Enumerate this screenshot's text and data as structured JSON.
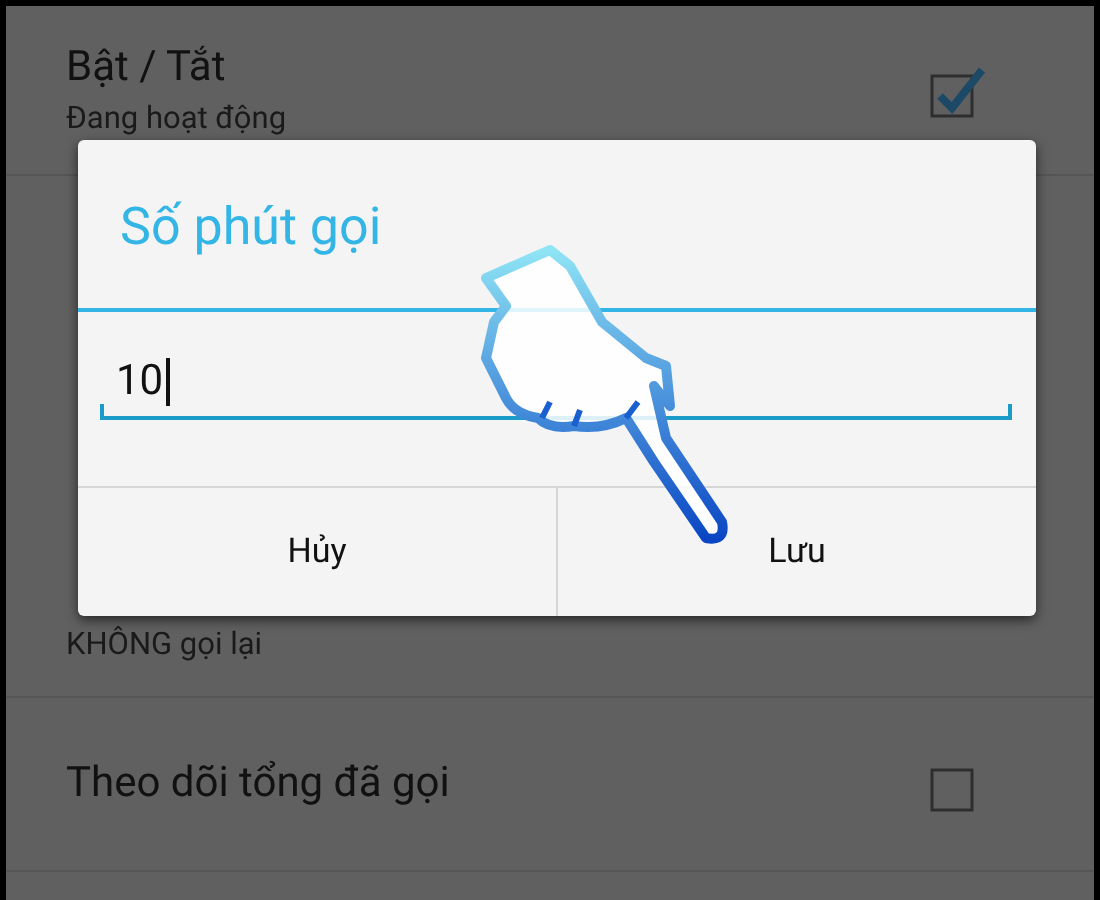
{
  "settings": [
    {
      "title": "Bật / Tắt",
      "subtitle": "Đang hoạt động",
      "checked": true
    },
    {
      "subtitle": "KHÔNG gọi lại"
    },
    {
      "title": "Theo dõi tổng đã gọi",
      "checked": false
    }
  ],
  "dialog": {
    "title": "Số phút gọi",
    "value": "10",
    "buttons": [
      "Hủy",
      "Lưu"
    ]
  }
}
